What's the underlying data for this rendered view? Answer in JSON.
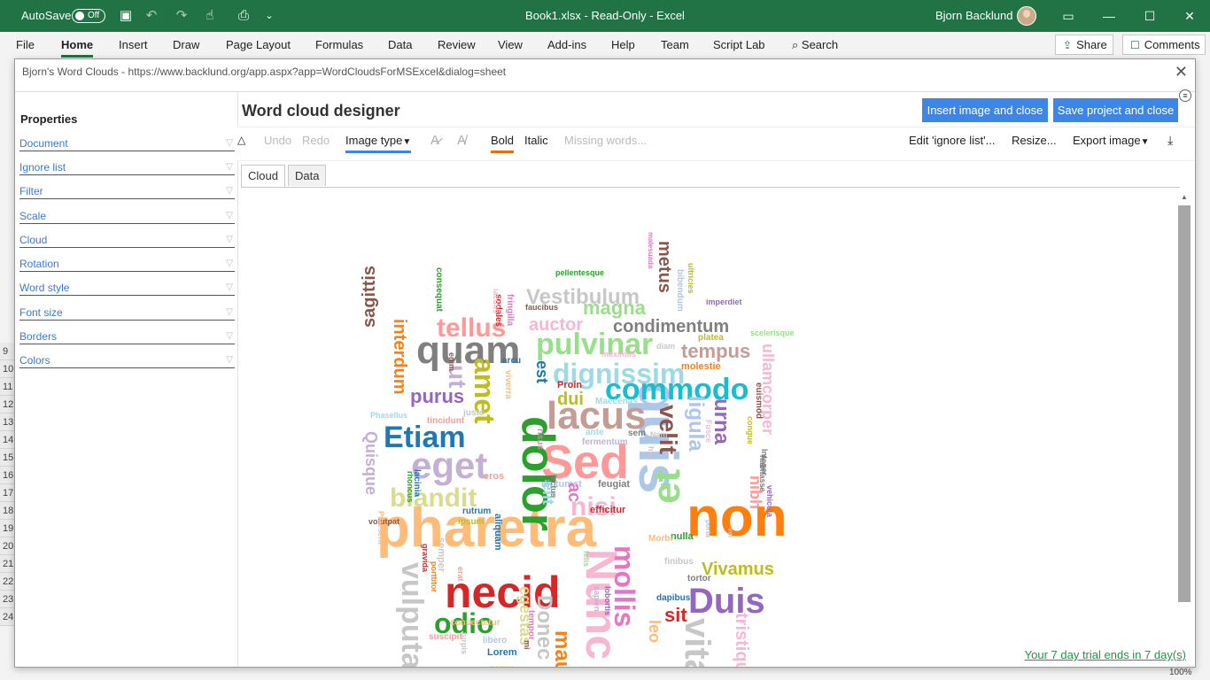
{
  "titlebar": {
    "autosave_label": "AutoSave",
    "autosave_state": "Off",
    "doc_title": "Book1.xlsx - Read-Only - Excel",
    "user_name": "Bjorn Backlund",
    "accent": "#217346"
  },
  "ribbon": {
    "tabs": [
      "File",
      "Home",
      "Insert",
      "Draw",
      "Page Layout",
      "Formulas",
      "Data",
      "Review",
      "View",
      "Add-ins",
      "Help",
      "Team",
      "Script Lab"
    ],
    "active_tab": "Home",
    "search_label": "Search",
    "share_label": "Share",
    "comments_label": "Comments"
  },
  "sheet": {
    "row_numbers": [
      "9",
      "10",
      "11",
      "12",
      "13",
      "14",
      "15",
      "16",
      "17",
      "18",
      "19",
      "20",
      "21",
      "22",
      "23",
      "24"
    ],
    "zoom": "100%"
  },
  "dialog": {
    "title": "Bjorn's Word Clouds - https://www.backlund.org/app.aspx?app=WordCloudsForMSExcel&dialog=sheet",
    "properties_title": "Properties",
    "properties": [
      "Document",
      "Ignore list",
      "Filter",
      "Scale",
      "Cloud",
      "Rotation",
      "Word style",
      "Font size",
      "Borders",
      "Colors"
    ],
    "designer_title": "Word cloud designer",
    "insert_button": "Insert image and close",
    "save_button": "Save project and close",
    "button_color": "#3c86e8",
    "toolbar": {
      "undo": "Undo",
      "redo": "Redo",
      "image_type": "Image type",
      "bold": "Bold",
      "italic": "Italic",
      "missing_words": "Missing words...",
      "edit_ignore": "Edit 'ignore list'...",
      "resize": "Resize...",
      "export_image": "Export image"
    },
    "tabs": [
      "Cloud",
      "Data"
    ],
    "active_tab": "Cloud",
    "trial_text": "Your 7 day trial ends in 7 day(s)"
  },
  "cloud_words": [
    {
      "t": "pharetra",
      "c": "#ffbb78"
    },
    {
      "t": "Sed",
      "c": "#ff9896"
    },
    {
      "t": "dolor",
      "c": "#2ca02c"
    },
    {
      "t": "non",
      "c": "#ff7f0e"
    },
    {
      "t": "quis",
      "c": "#aec7e8"
    },
    {
      "t": "quam",
      "c": "#7f7f7f"
    },
    {
      "t": "necid",
      "c": "#d62728"
    },
    {
      "t": "Nunc",
      "c": "#f7b6d2"
    },
    {
      "t": "lacus",
      "c": "#c49c94"
    },
    {
      "t": "et",
      "c": "#98df8a"
    },
    {
      "t": "Duis",
      "c": "#9467bd"
    },
    {
      "t": "eget",
      "c": "#c5b0d5"
    },
    {
      "t": "Etiam",
      "c": "#1f77b4"
    },
    {
      "t": "commodo",
      "c": "#17becf"
    },
    {
      "t": "pulvinar",
      "c": "#98df8a"
    },
    {
      "t": "dignissim",
      "c": "#9edae5"
    },
    {
      "t": "tellus",
      "c": "#ff9896"
    },
    {
      "t": "blandit",
      "c": "#dbdb8d"
    },
    {
      "t": "nisi",
      "c": "#f7b6d2"
    },
    {
      "t": "mollis",
      "c": "#e377c2"
    },
    {
      "t": "odio",
      "c": "#2ca02c"
    },
    {
      "t": "vulputate",
      "c": "#c7c7c7"
    },
    {
      "t": "amet",
      "c": "#bcbd22"
    },
    {
      "t": "velit",
      "c": "#8c564b"
    },
    {
      "t": "ligula",
      "c": "#aec7e8"
    },
    {
      "t": "urna",
      "c": "#9467bd"
    },
    {
      "t": "vitae",
      "c": "#c7c7c7"
    },
    {
      "t": "Vestibulum",
      "c": "#c7c7c7"
    },
    {
      "t": "condimentum",
      "c": "#7f7f7f"
    },
    {
      "t": "magna",
      "c": "#98df8a"
    },
    {
      "t": "auctor",
      "c": "#f7b6d2"
    },
    {
      "t": "tempus",
      "c": "#c49c94"
    },
    {
      "t": "ullamcorper",
      "c": "#f7b6d2"
    },
    {
      "t": "interdum",
      "c": "#ff7f0e"
    },
    {
      "t": "sagittis",
      "c": "#8c564b"
    },
    {
      "t": "purus",
      "c": "#9467bd"
    },
    {
      "t": "ut",
      "c": "#c5b0d5"
    },
    {
      "t": "Vivamus",
      "c": "#bcbd22"
    },
    {
      "t": "metus",
      "c": "#8c564b"
    },
    {
      "t": "Quisque",
      "c": "#c5b0d5"
    },
    {
      "t": "sit",
      "c": "#d62728"
    },
    {
      "t": "leo",
      "c": "#ffbb78"
    },
    {
      "t": "tristique",
      "c": "#f7b6d2"
    },
    {
      "t": "Donec",
      "c": "#c7c7c7"
    },
    {
      "t": "mauris",
      "c": "#ff7f0e"
    },
    {
      "t": "egestas",
      "c": "#dbdb8d"
    },
    {
      "t": "nibh",
      "c": "#ff9896"
    },
    {
      "t": "dui",
      "c": "#bcbd22"
    },
    {
      "t": "est",
      "c": "#1f77b4"
    },
    {
      "t": "Proin",
      "c": "#d62728"
    },
    {
      "t": "molestie",
      "c": "#ff7f0e"
    },
    {
      "t": "platea",
      "c": "#bcbd22"
    },
    {
      "t": "arcu",
      "c": "#1f77b4"
    },
    {
      "t": "viverra",
      "c": "#ffbb78"
    },
    {
      "t": "Maecenas",
      "c": "#9edae5"
    },
    {
      "t": "justo",
      "c": "#c7c7c7"
    },
    {
      "t": "tincidunt",
      "c": "#ff9896"
    },
    {
      "t": "Phasellus",
      "c": "#9edae5"
    },
    {
      "t": "sem",
      "c": "#7f7f7f"
    },
    {
      "t": "ante",
      "c": "#9edae5"
    },
    {
      "t": "fermentum",
      "c": "#c5b0d5"
    },
    {
      "t": "feugiat",
      "c": "#7f7f7f"
    },
    {
      "t": "dictumst",
      "c": "#aec7e8"
    },
    {
      "t": "eros",
      "c": "#ff9896"
    },
    {
      "t": "efficitur",
      "c": "#d62728"
    },
    {
      "t": "rutrum",
      "c": "#1f77b4"
    },
    {
      "t": "ipsum",
      "c": "#bcbd22"
    },
    {
      "t": "nulla",
      "c": "#2ca02c"
    },
    {
      "t": "Morbi",
      "c": "#ffbb78"
    },
    {
      "t": "finibus",
      "c": "#c7c7c7"
    },
    {
      "t": "tortor",
      "c": "#7f7f7f"
    },
    {
      "t": "dapibus",
      "c": "#1f77b4"
    },
    {
      "t": "consectetur",
      "c": "#ffbb78"
    },
    {
      "t": "suscipit",
      "c": "#ff9896"
    },
    {
      "t": "libero",
      "c": "#aec7e8"
    },
    {
      "t": "Lorem",
      "c": "#1f77b4"
    },
    {
      "t": "neque",
      "c": "#dbdb8d"
    },
    {
      "t": "volutpat",
      "c": "#8c564b"
    },
    {
      "t": "semper",
      "c": "#c7c7c7"
    },
    {
      "t": "gravida",
      "c": "#d62728"
    },
    {
      "t": "pellentesque",
      "c": "#2ca02c"
    },
    {
      "t": "faucibus",
      "c": "#8c564b"
    },
    {
      "t": "fringilla",
      "c": "#e377c2"
    },
    {
      "t": "sodales",
      "c": "#d62728"
    },
    {
      "t": "consequat",
      "c": "#2ca02c"
    },
    {
      "t": "imperdiet",
      "c": "#9467bd"
    },
    {
      "t": "scelerisque",
      "c": "#98df8a"
    },
    {
      "t": "diam",
      "c": "#c7c7c7"
    },
    {
      "t": "maximus",
      "c": "#f7b6d2"
    },
    {
      "t": "ultricies",
      "c": "#bcbd22"
    },
    {
      "t": "bibendum",
      "c": "#aec7e8"
    },
    {
      "t": "malesuada",
      "c": "#e377c2"
    },
    {
      "t": "lacinia",
      "c": "#1f77b4"
    },
    {
      "t": "rhoncus",
      "c": "#2ca02c"
    },
    {
      "t": "habitasse",
      "c": "#7f7f7f"
    },
    {
      "t": "euismod",
      "c": "#8c564b"
    },
    {
      "t": "congue",
      "c": "#bcbd22"
    },
    {
      "t": "Fusce",
      "c": "#f7b6d2"
    },
    {
      "t": "porta",
      "c": "#aec7e8"
    },
    {
      "t": "vel",
      "c": "#c7c7c7"
    },
    {
      "t": "elit",
      "c": "#9edae5"
    },
    {
      "t": "ac",
      "c": "#e377c2"
    },
    {
      "t": "aliquam",
      "c": "#1f77b4"
    },
    {
      "t": "lectus",
      "c": "#7f7f7f"
    },
    {
      "t": "risus",
      "c": "#e377c2"
    },
    {
      "t": "enim",
      "c": "#8c564b"
    },
    {
      "t": "porttitor",
      "c": "#ff7f0e"
    },
    {
      "t": "erat",
      "c": "#ff9896"
    },
    {
      "t": "turpis",
      "c": "#c7c7c7"
    },
    {
      "t": "tempor",
      "c": "#e377c2"
    },
    {
      "t": "sapien",
      "c": "#c5b0d5"
    },
    {
      "t": "lobortis",
      "c": "#9467bd"
    },
    {
      "t": "felis",
      "c": "#98df8a"
    },
    {
      "t": "mi",
      "c": "#8c564b"
    },
    {
      "t": "Nam",
      "c": "#c7c7c7"
    },
    {
      "t": "hac",
      "c": "#c7c7c7"
    },
    {
      "t": "Integer",
      "c": "#7f7f7f"
    },
    {
      "t": "vehicula",
      "c": "#9467bd"
    },
    {
      "t": "Praesent",
      "c": "#ffbb78"
    },
    {
      "t": "iaculis",
      "c": "#f7b6d2"
    }
  ]
}
